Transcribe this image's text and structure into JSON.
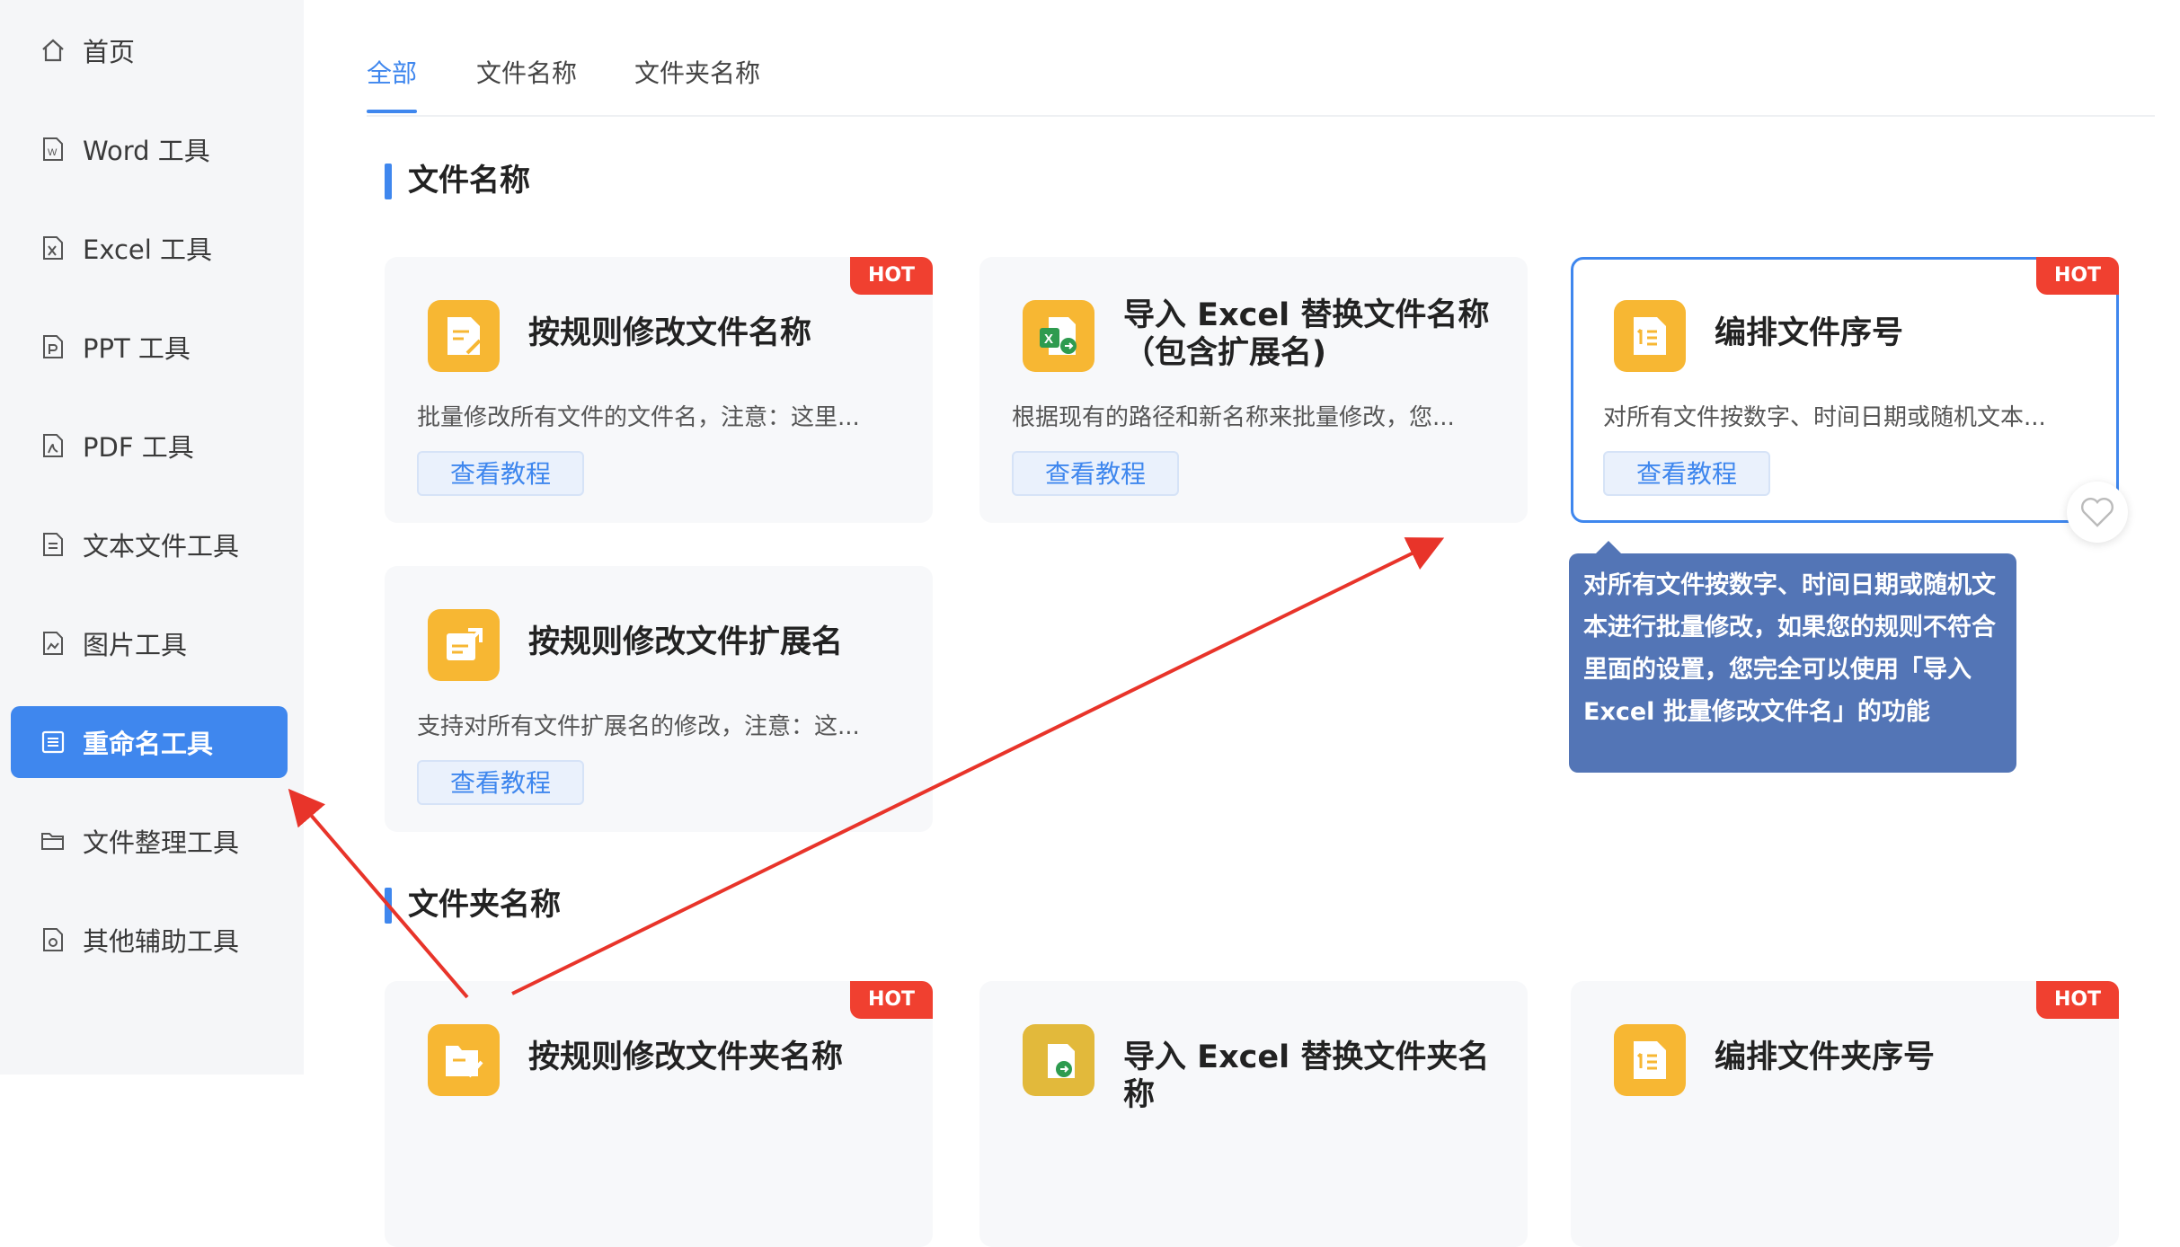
{
  "sidebar": {
    "items": [
      {
        "label": "首页",
        "icon": "home-icon"
      },
      {
        "label": "Word 工具",
        "icon": "word-file-icon"
      },
      {
        "label": "Excel 工具",
        "icon": "excel-file-icon"
      },
      {
        "label": "PPT 工具",
        "icon": "ppt-file-icon"
      },
      {
        "label": "PDF 工具",
        "icon": "pdf-file-icon"
      },
      {
        "label": "文本文件工具",
        "icon": "text-file-icon"
      },
      {
        "label": "图片工具",
        "icon": "image-file-icon"
      },
      {
        "label": "重命名工具",
        "icon": "rename-icon",
        "active": true
      },
      {
        "label": "文件整理工具",
        "icon": "folder-icon"
      },
      {
        "label": "其他辅助工具",
        "icon": "misc-tool-icon"
      }
    ]
  },
  "tabs": [
    {
      "label": "全部",
      "active": true
    },
    {
      "label": "文件名称"
    },
    {
      "label": "文件夹名称"
    }
  ],
  "sections": {
    "file_name": {
      "title": "文件名称"
    },
    "folder_name": {
      "title": "文件夹名称"
    }
  },
  "cards": [
    {
      "title": "按规则修改文件名称",
      "desc": "批量修改所有文件的文件名，注意：这里...",
      "button": "查看教程",
      "hot": "HOT",
      "icon": "document-edit-icon"
    },
    {
      "title": "导入 Excel 替换文件名称（包含扩展名)",
      "desc": "根据现有的路径和新名称来批量修改，您...",
      "button": "查看教程",
      "icon": "excel-import-icon"
    },
    {
      "title": "编排文件序号",
      "desc": "对所有文件按数字、时间日期或随机文本...",
      "button": "查看教程",
      "hot": "HOT",
      "icon": "numbered-list-icon"
    },
    {
      "title": "按规则修改文件扩展名",
      "desc": "支持对所有文件扩展名的修改，注意：这...",
      "button": "查看教程",
      "icon": "extension-edit-icon"
    },
    {
      "title": "按规则修改文件夹名称",
      "hot": "HOT",
      "icon": "folder-edit-icon"
    },
    {
      "title": "导入 Excel 替换文件夹名称",
      "icon": "excel-folder-icon"
    },
    {
      "title": "编排文件夹序号",
      "hot": "HOT",
      "icon": "folder-numbered-icon"
    }
  ],
  "tooltip": {
    "text": "对所有文件按数字、时间日期或随机文本进行批量修改，如果您的规则不符合里面的设置，您完全可以使用「导入 Excel 批量修改文件名」的功能"
  },
  "colors": {
    "accent": "#3f87ee",
    "hot": "#f04030",
    "icon_bg": "#f7b733",
    "tooltip_bg": "#5375b6",
    "arrow": "#e8342a"
  }
}
